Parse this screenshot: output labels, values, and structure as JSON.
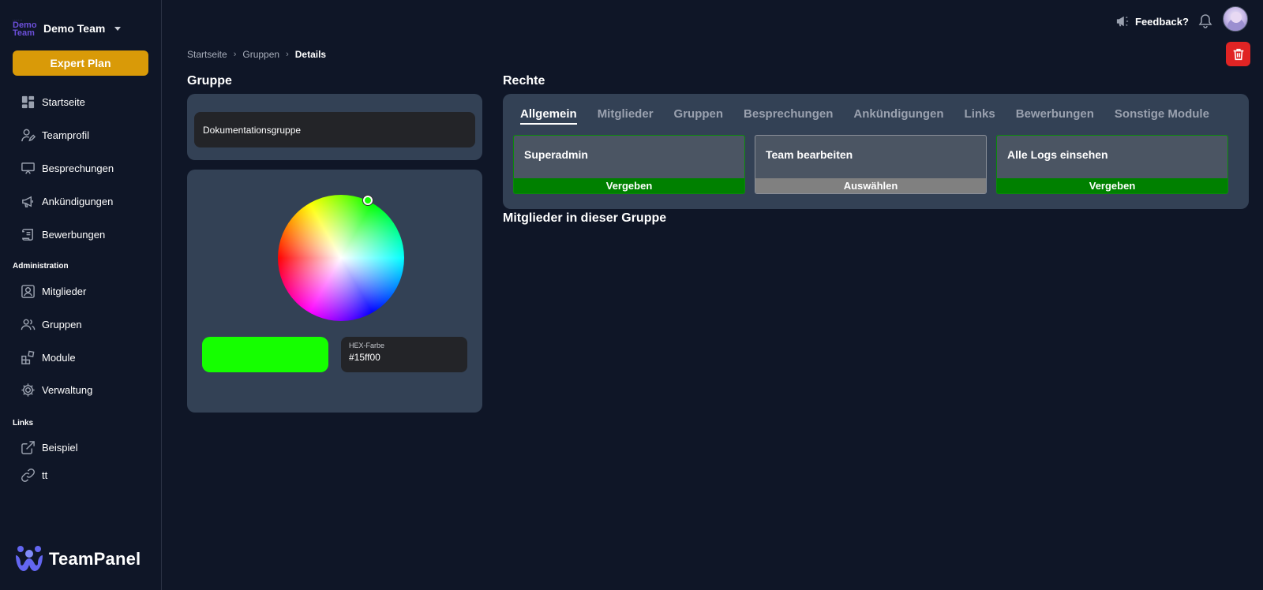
{
  "sidebar": {
    "team_logo_top": "Demo",
    "team_logo_bottom": "Team",
    "team_name": "Demo Team",
    "plan_label": "Expert Plan",
    "nav": [
      {
        "label": "Startseite",
        "icon": "dashboard-icon"
      },
      {
        "label": "Teamprofil",
        "icon": "user-edit-icon"
      },
      {
        "label": "Besprechungen",
        "icon": "presentation-icon"
      },
      {
        "label": "Ankündigungen",
        "icon": "megaphone-icon"
      },
      {
        "label": "Bewerbungen",
        "icon": "scroll-icon"
      }
    ],
    "admin_label": "Administration",
    "admin_nav": [
      {
        "label": "Mitglieder",
        "icon": "id-card-icon"
      },
      {
        "label": "Gruppen",
        "icon": "users-icon"
      },
      {
        "label": "Module",
        "icon": "modules-icon"
      },
      {
        "label": "Verwaltung",
        "icon": "gear-icon"
      }
    ],
    "links_label": "Links",
    "links": [
      {
        "label": "Beispiel",
        "icon": "external-link-icon"
      },
      {
        "label": "tt",
        "icon": "link-icon"
      }
    ],
    "brand": "TeamPanel"
  },
  "topbar": {
    "feedback_label": "Feedback?"
  },
  "breadcrumb": [
    "Startseite",
    "Gruppen",
    "Details"
  ],
  "group": {
    "heading": "Gruppe",
    "name_value": "Dokumentationsgruppe",
    "hex_label": "HEX-Farbe",
    "hex_value": "#15ff00"
  },
  "rights": {
    "heading": "Rechte",
    "tabs": [
      "Allgemein",
      "Mitglieder",
      "Gruppen",
      "Besprechungen",
      "Ankündigungen",
      "Links",
      "Bewerbungen",
      "Sonstige Module"
    ],
    "active_tab": 0,
    "permissions": [
      {
        "title": "Superadmin",
        "action": "Vergeben",
        "state": "granted"
      },
      {
        "title": "Team bearbeiten",
        "action": "Auswählen",
        "state": "neutral"
      },
      {
        "title": "Alle Logs einsehen",
        "action": "Vergeben",
        "state": "granted"
      }
    ]
  },
  "members": {
    "heading": "Mitglieder in dieser Gruppe"
  },
  "colors": {
    "background": "#0f1627",
    "panel": "#334155",
    "plan": "#d99a08",
    "granted": "#008000",
    "neutral": "#808080",
    "delete": "#e02424",
    "selected_color": "#15ff00"
  }
}
